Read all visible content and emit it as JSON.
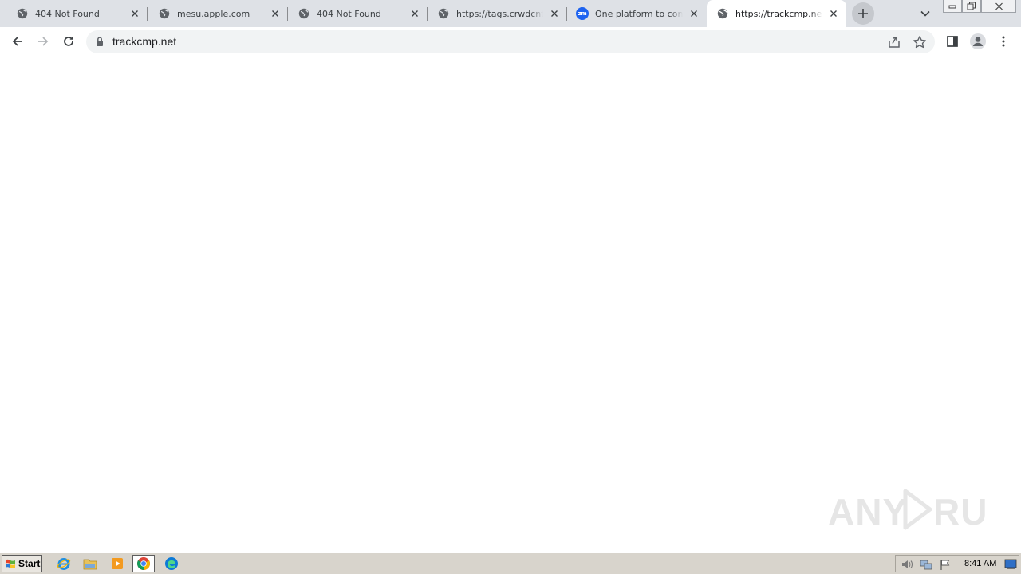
{
  "browser": {
    "tabs": [
      {
        "title": "404 Not Found",
        "favicon": "globe-icon",
        "active": false
      },
      {
        "title": "mesu.apple.com",
        "favicon": "globe-icon",
        "active": false
      },
      {
        "title": "404 Not Found",
        "favicon": "globe-icon",
        "active": false
      },
      {
        "title": "https://tags.crwdcntrl.net",
        "favicon": "globe-icon",
        "active": false
      },
      {
        "title": "One platform to connect",
        "favicon": "zoom-logo-icon",
        "favicon_text": "zm",
        "active": false
      },
      {
        "title": "https://trackcmp.net",
        "favicon": "globe-icon",
        "active": true
      }
    ],
    "address_bar": {
      "url": "trackcmp.net"
    }
  },
  "page": {
    "watermark": "ANY RUN"
  },
  "taskbar": {
    "start_label": "Start",
    "apps": [
      "internet-explorer-icon",
      "file-explorer-icon",
      "media-player-icon",
      "chrome-icon",
      "edge-icon"
    ],
    "clock": "8:41 AM"
  },
  "colors": {
    "tabstrip_bg": "#dee1e6",
    "omnibox_bg": "#f1f3f4",
    "taskbar_bg": "#d8d4cc",
    "zoom_blue": "#1e63f0"
  }
}
